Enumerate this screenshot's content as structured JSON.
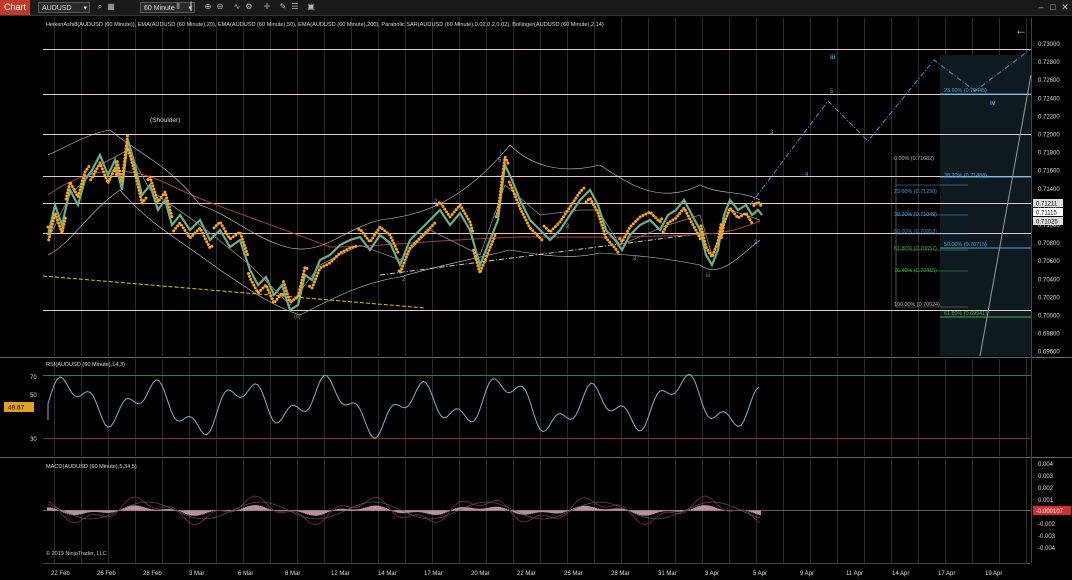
{
  "toolbar": {
    "tab_label": "Chart",
    "symbol": "AUDUSD",
    "interval": "60 Minute"
  },
  "indicator_line": "HeikenAshi8(AUDUSD (60 Minute)), EMA(AUDUSD (60 Minute),20), EMA(AUDUSD (60 Minute),50), EMA(AUDUSD (60 Minute),200), Parabolic SAR(AUDUSD (60 Minute),0.02,0.2,0.02), Bollinger(AUDUSD (60 Minute),2,14)",
  "price_axis": [
    "0.73000",
    "0.72800",
    "0.72600",
    "0.72400",
    "0.72200",
    "0.72000",
    "0.71800",
    "0.71600",
    "0.71400",
    "0.71200",
    "0.71000",
    "0.70800",
    "0.70600",
    "0.70400",
    "0.70200",
    "0.70000",
    "0.69800",
    "0.69600"
  ],
  "price_badges": {
    "a": "0.71211",
    "b": "0.71115",
    "c": "0.71025"
  },
  "annotations": {
    "shoulder": "(Shoulder)",
    "w_ii": "(ii)",
    "w_iii": "iii",
    "w_iv": "iv",
    "w_i": "i",
    "w_3": "3",
    "w_4": "4",
    "w_5": "5",
    "w_2a": "2",
    "w_2b": "2",
    "w_2c": "2",
    "w_4b": "4",
    "w_5b": "5",
    "w_iii_low": "iii",
    "w_2d": "2",
    "w_2e": "2"
  },
  "fib_left": [
    {
      "label": "0.00% (0.71682)",
      "color": "#bbbbbb"
    },
    {
      "label": "23.60% (0.71250)",
      "color": "#4aa3df"
    },
    {
      "label": "38.20% (0.71049)",
      "color": "#4aa3df"
    },
    {
      "label": "50.00% (0.70853)",
      "color": "#3b82c4"
    },
    {
      "label": "61.80% (0.70657)",
      "color": "#3fae49"
    },
    {
      "label": "76.40% (0.70415)",
      "color": "#3fae49"
    },
    {
      "label": "100.00% (0.70024)",
      "color": "#bbbbbb"
    }
  ],
  "fib_right": [
    {
      "label": "23.60% (0.72445)",
      "color": "#4aa3df"
    },
    {
      "label": "38.20% (0.71488)",
      "color": "#4aa3df"
    },
    {
      "label": "50.00% (0.70715)",
      "color": "#4aa3df"
    },
    {
      "label": "61.80% (0.69941)",
      "color": "#3fae49"
    }
  ],
  "rsi": {
    "title": "RSI(AUDUSD (60 Minute),14,3)",
    "value": "49.67",
    "levels": [
      "70",
      "50",
      "30"
    ]
  },
  "macd": {
    "title": "MACD(AUDUSD (60 Minute),5,34,5)",
    "levels": [
      "0.004",
      "0.003",
      "0.002",
      "0.001",
      "-0.001",
      "-0.002",
      "-0.003",
      "-0.004"
    ],
    "value": "-0.000107",
    "copyright": "© 2019 NinjaTrader, LLC"
  },
  "dates": [
    "22 Feb",
    "26 Feb",
    "28 Feb",
    "3 Mar",
    "6 Mar",
    "8 Mar",
    "12 Mar",
    "14 Mar",
    "17 Mar",
    "20 Mar",
    "22 Mar",
    "26 Mar",
    "28 Mar",
    "31 Mar",
    "3 Apr",
    "5 Apr",
    "9 Apr",
    "11 Apr",
    "14 Apr",
    "17 Apr",
    "19 Apr"
  ],
  "colors": {
    "background": "#000000",
    "hline": "#e8c9c9",
    "sar": "#f5a623",
    "projection": "#4a90e2",
    "rsi_line": "#7fb0d0"
  }
}
